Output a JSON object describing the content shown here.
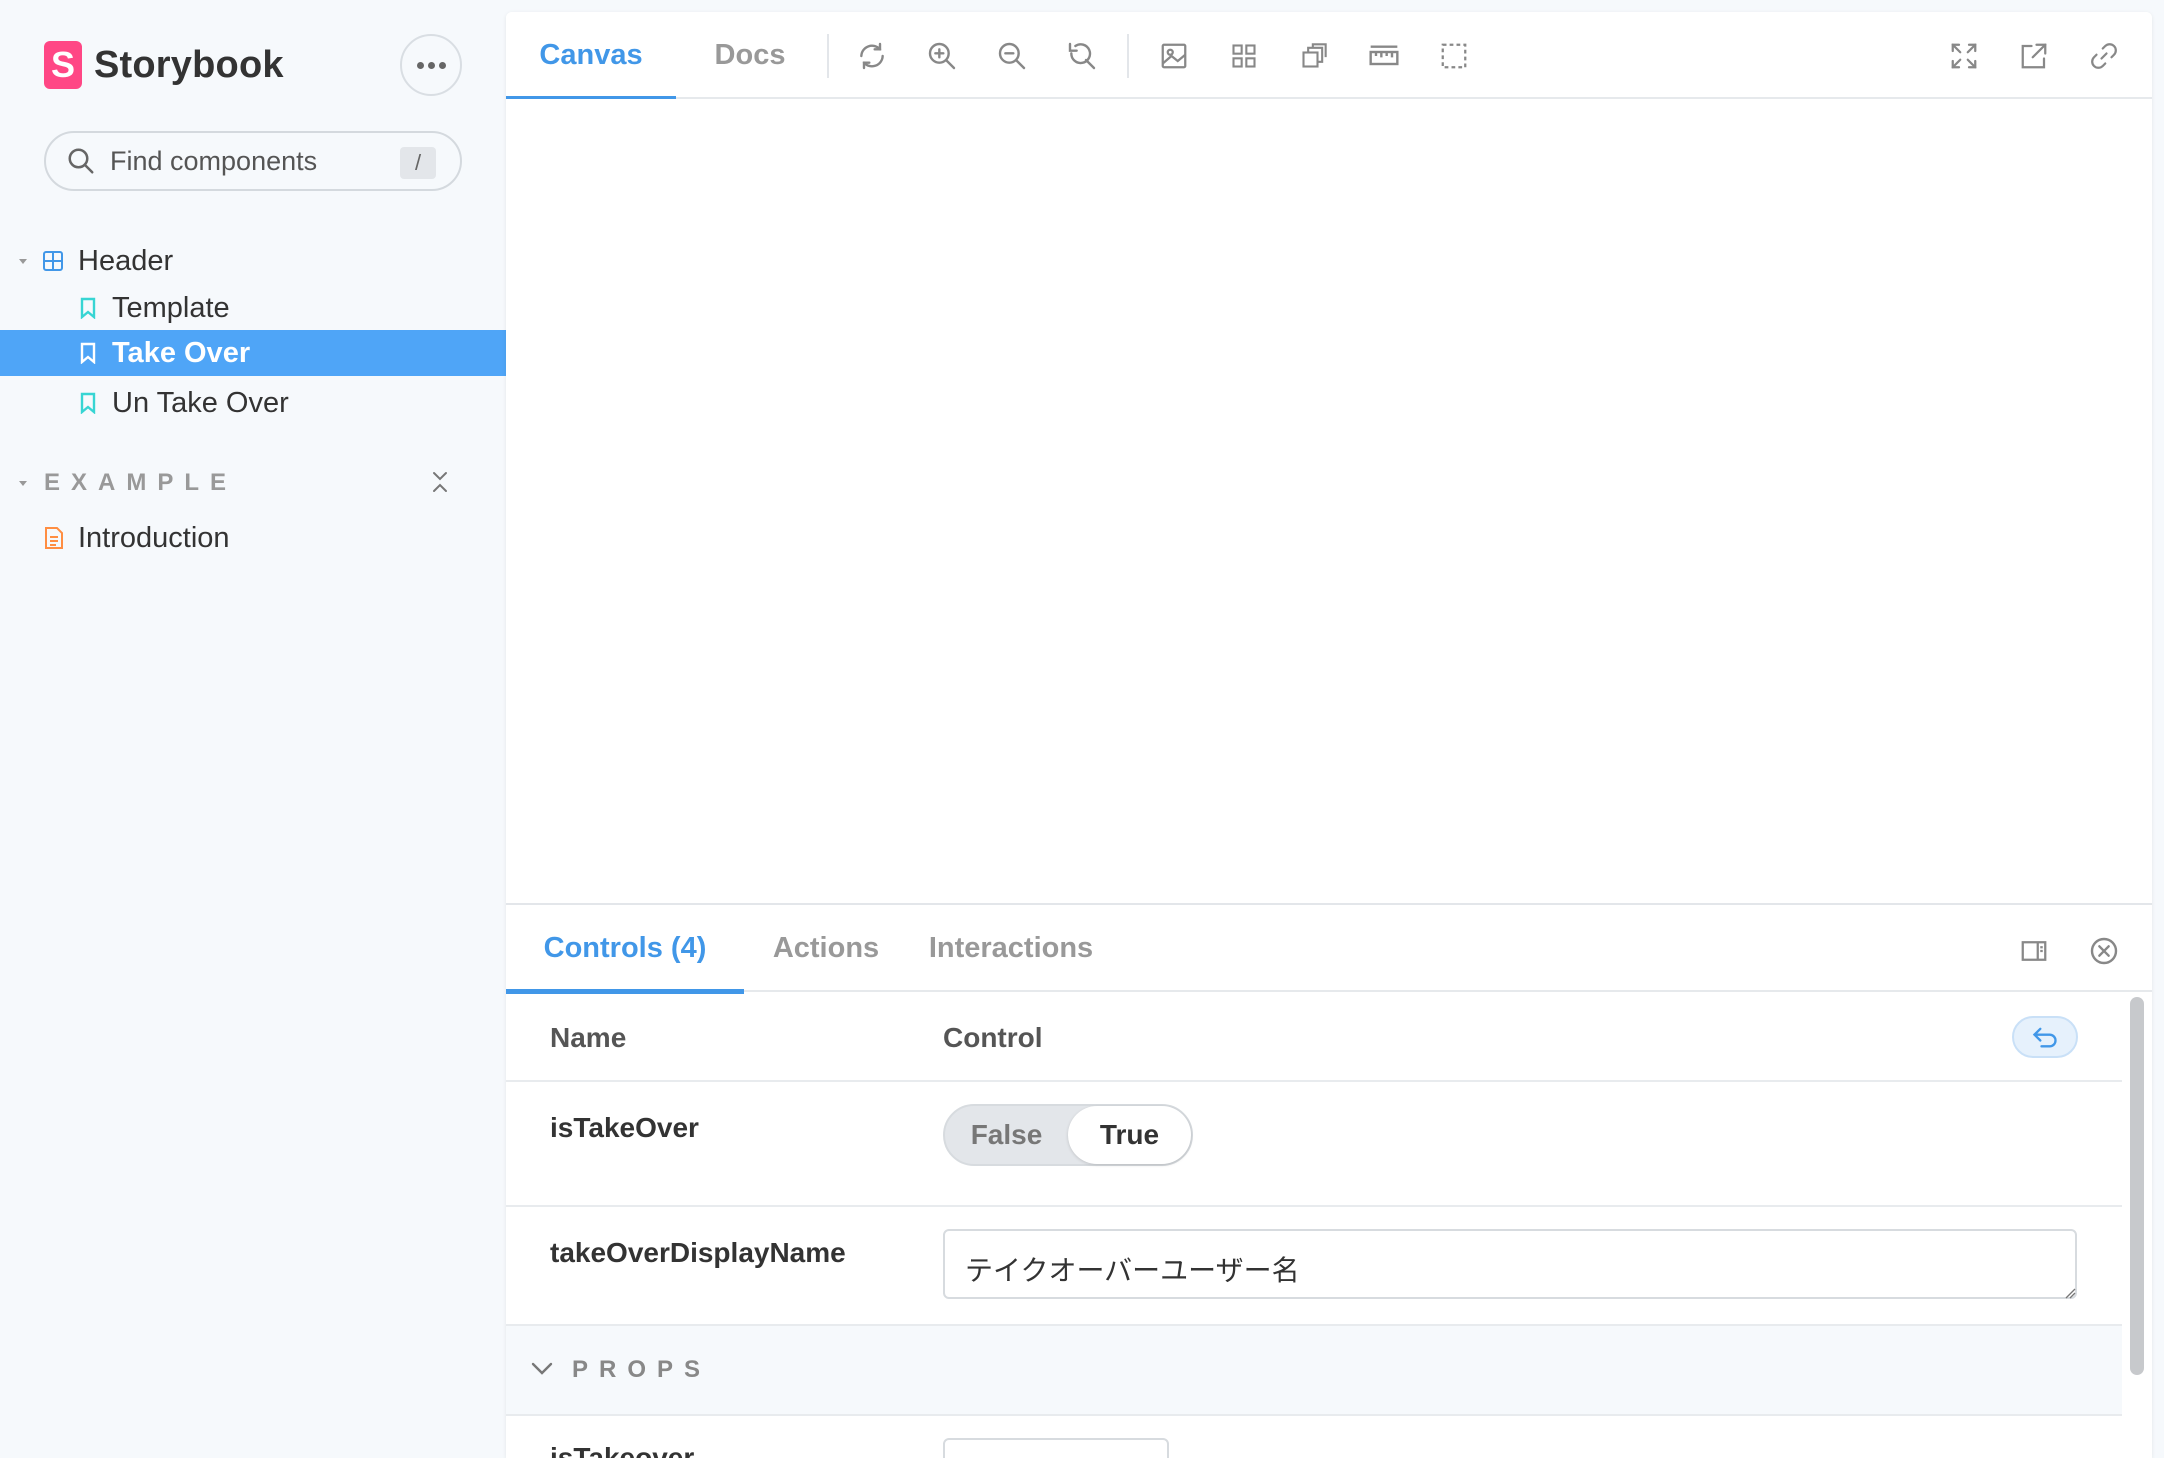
{
  "sidebar": {
    "brand": "Storybook",
    "brand_logo_letter": "S",
    "search": {
      "placeholder": "Find components",
      "shortcut": "/"
    },
    "tree": [
      {
        "label": "Header",
        "kind": "component",
        "expanded": true
      },
      {
        "label": "Template",
        "kind": "story",
        "selected": false
      },
      {
        "label": "Take Over",
        "kind": "story",
        "selected": true
      },
      {
        "label": "Un Take Over",
        "kind": "story",
        "selected": false
      }
    ],
    "group": {
      "label": "EXAMPLE",
      "items": [
        {
          "label": "Introduction",
          "kind": "document"
        }
      ]
    }
  },
  "toolbar": {
    "tabs": [
      {
        "label": "Canvas",
        "active": true
      },
      {
        "label": "Docs",
        "active": false
      }
    ],
    "tools": [
      "refresh-icon",
      "zoom-in-icon",
      "zoom-out-icon",
      "zoom-reset-icon",
      "background-icon",
      "grid-icon",
      "viewport-icon",
      "measure-icon",
      "outline-icon"
    ],
    "right_tools": [
      "fullscreen-icon",
      "open-new-tab-icon",
      "copy-link-icon"
    ]
  },
  "addons": {
    "tabs": [
      {
        "label": "Controls (4)",
        "active": true
      },
      {
        "label": "Actions",
        "active": false
      },
      {
        "label": "Interactions",
        "active": false
      }
    ],
    "table": {
      "headers": {
        "name": "Name",
        "control": "Control"
      },
      "rows": [
        {
          "name": "isTakeOver",
          "type": "boolean",
          "options": [
            "False",
            "True"
          ],
          "value": "True"
        },
        {
          "name": "takeOverDisplayName",
          "type": "text",
          "value": "テイクオーバーユーザー名"
        }
      ],
      "section": {
        "label": "PROPS",
        "expanded": true
      },
      "partial_row": {
        "name": "isTakeover"
      }
    }
  },
  "colors": {
    "accent": "#4197e8",
    "selected_bg": "#4fa5f7",
    "brand": "#ff4785",
    "story_icon": "#37d5d3",
    "component_icon": "#4197e8",
    "doc_icon": "#ff8e42"
  }
}
